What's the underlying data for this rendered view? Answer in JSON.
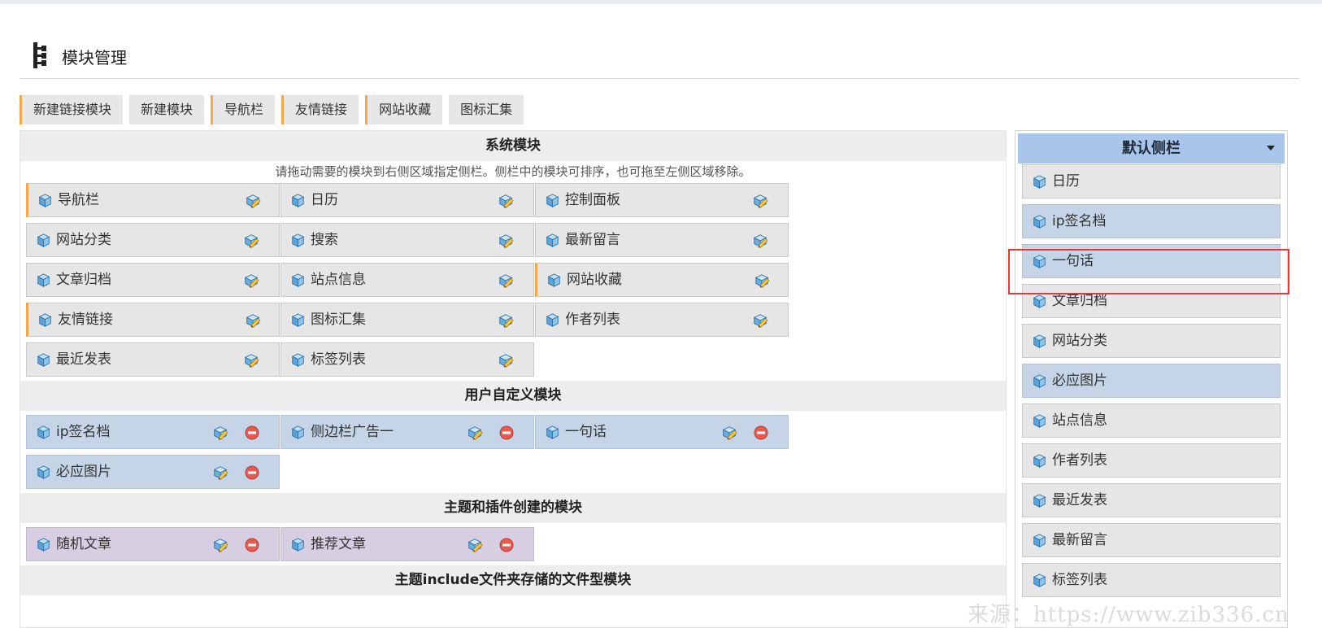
{
  "page": {
    "title": "模块管理"
  },
  "tabs": [
    {
      "label": "新建链接模块",
      "flag": true
    },
    {
      "label": "新建模块",
      "flag": false
    },
    {
      "label": "导航栏",
      "flag": true
    },
    {
      "label": "友情链接",
      "flag": true
    },
    {
      "label": "网站收藏",
      "flag": true
    },
    {
      "label": "图标汇集",
      "flag": false
    }
  ],
  "system": {
    "title": "系统模块",
    "hint": "请拖动需要的模块到右侧区域指定侧栏。侧栏中的模块可排序，也可拖至左侧区域移除。",
    "items": [
      {
        "label": "导航栏",
        "flag": true
      },
      {
        "label": "日历",
        "flag": false
      },
      {
        "label": "控制面板",
        "flag": false
      },
      {
        "label": "网站分类",
        "flag": false
      },
      {
        "label": "搜索",
        "flag": false
      },
      {
        "label": "最新留言",
        "flag": false
      },
      {
        "label": "文章归档",
        "flag": false
      },
      {
        "label": "站点信息",
        "flag": false
      },
      {
        "label": "网站收藏",
        "flag": true
      },
      {
        "label": "友情链接",
        "flag": true
      },
      {
        "label": "图标汇集",
        "flag": false
      },
      {
        "label": "作者列表",
        "flag": false
      },
      {
        "label": "最近发表",
        "flag": false
      },
      {
        "label": "标签列表",
        "flag": false
      }
    ]
  },
  "user": {
    "title": "用户自定义模块",
    "items": [
      {
        "label": "ip签名档"
      },
      {
        "label": "侧边栏广告一"
      },
      {
        "label": "一句话"
      },
      {
        "label": "必应图片"
      }
    ]
  },
  "theme": {
    "title": "主题和插件创建的模块",
    "items": [
      {
        "label": "随机文章"
      },
      {
        "label": "推荐文章"
      }
    ]
  },
  "include": {
    "title": "主题include文件夹存储的文件型模块"
  },
  "sidebar": {
    "title": "默认侧栏",
    "items": [
      {
        "label": "日历",
        "user": false
      },
      {
        "label": "ip签名档",
        "user": true
      },
      {
        "label": "一句话",
        "user": true
      },
      {
        "label": "文章归档",
        "user": false
      },
      {
        "label": "网站分类",
        "user": false
      },
      {
        "label": "必应图片",
        "user": true
      },
      {
        "label": "站点信息",
        "user": false
      },
      {
        "label": "作者列表",
        "user": false
      },
      {
        "label": "最近发表",
        "user": false
      },
      {
        "label": "最新留言",
        "user": false
      },
      {
        "label": "标签列表",
        "user": false
      }
    ]
  },
  "watermark": "来源：https://www.zib336.cn",
  "icons": {
    "cube": "cube-icon",
    "edit": "edit-pencil-icon",
    "delete": "delete-minus-icon",
    "tree": "tree-structure-icon",
    "caret": "caret-down-icon"
  },
  "colors": {
    "accent_flag": "#f3a64a",
    "user_module": "#c5d4e6",
    "theme_module": "#d7cfe1",
    "sidebar_head": "#a9c6ea",
    "highlight": "#e53935"
  }
}
